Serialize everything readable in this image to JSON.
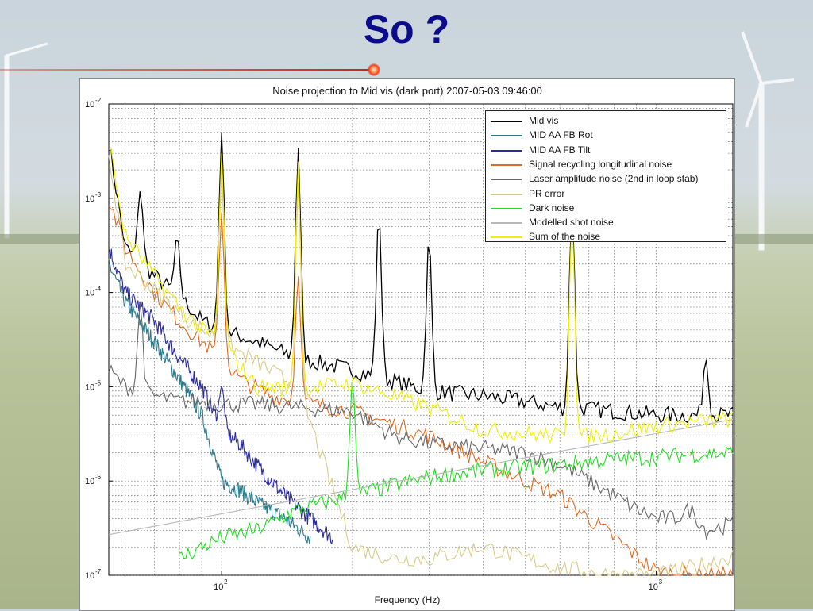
{
  "slide": {
    "title": "So ?"
  },
  "chart_data": {
    "type": "line",
    "title": "Noise projection to Mid vis (dark port) 2007-05-03 09:46:00",
    "xlabel": "Frequency (Hz)",
    "ylabel": "",
    "xscale": "log",
    "yscale": "log",
    "xlim": [
      55,
      1500
    ],
    "ylim": [
      1e-07,
      0.01
    ],
    "grid": true,
    "legend_position": "top-right",
    "x_ticks": [
      {
        "value": 100,
        "label": "10",
        "exp": "2"
      },
      {
        "value": 1000,
        "label": "10",
        "exp": "3"
      }
    ],
    "y_ticks": [
      {
        "value": 1e-07,
        "label": "10",
        "exp": "-7"
      },
      {
        "value": 1e-06,
        "label": "10",
        "exp": "-6"
      },
      {
        "value": 1e-05,
        "label": "10",
        "exp": "-5"
      },
      {
        "value": 0.0001,
        "label": "10",
        "exp": "-4"
      },
      {
        "value": 0.001,
        "label": "10",
        "exp": "-3"
      },
      {
        "value": 0.01,
        "label": "10",
        "exp": "-2"
      }
    ],
    "series": [
      {
        "name": "Mid vis",
        "color": "#000000",
        "x": [
          55,
          60,
          70,
          80,
          90,
          100,
          120,
          150,
          200,
          300,
          400,
          500,
          600,
          650,
          800,
          1000,
          1200,
          1500
        ],
        "y": [
          0.004,
          0.0003,
          0.00015,
          9e-05,
          5e-05,
          4e-05,
          3e-05,
          2e-05,
          1.5e-05,
          9e-06,
          8e-06,
          7e-06,
          6e-06,
          6e-06,
          5.5e-06,
          5e-06,
          5e-06,
          5e-06
        ],
        "peaks": [
          [
            65,
            0.0012
          ],
          [
            79,
            0.0004
          ],
          [
            100,
            0.005
          ],
          [
            150,
            0.0035
          ],
          [
            230,
            0.0007
          ],
          [
            300,
            0.0004
          ],
          [
            640,
            0.001
          ],
          [
            1300,
            2e-05
          ]
        ]
      },
      {
        "name": "MID AA FB Rot",
        "color": "#2a7a8c",
        "x": [
          55,
          60,
          70,
          80,
          90,
          100,
          110,
          120,
          140,
          160
        ],
        "y": [
          0.0002,
          8e-05,
          3e-05,
          1.2e-05,
          5e-06,
          1e-06,
          8e-07,
          6e-07,
          4e-07,
          2.5e-07
        ],
        "peaks": []
      },
      {
        "name": "MID AA FB Tilt",
        "color": "#2a2aa0",
        "x": [
          55,
          60,
          70,
          80,
          90,
          100,
          110,
          120,
          140,
          160,
          180
        ],
        "y": [
          0.0003,
          0.0001,
          5e-05,
          2e-05,
          1e-05,
          3.5e-06,
          2.5e-06,
          1.5e-06,
          7e-07,
          4e-07,
          2.5e-07
        ],
        "peaks": [
          [
            100,
            1e-05
          ]
        ]
      },
      {
        "name": "Signal recycling longitudinal noise",
        "color": "#e06820",
        "x": [
          55,
          60,
          70,
          80,
          90,
          100,
          110,
          130,
          150,
          200,
          300,
          400,
          500,
          600,
          700,
          800,
          900,
          1000,
          1200,
          1500
        ],
        "y": [
          0.001,
          0.0003,
          0.0001,
          5e-05,
          3e-05,
          2e-05,
          1.2e-05,
          8e-06,
          7e-06,
          5.5e-06,
          3e-06,
          1.6e-06,
          1e-06,
          7e-07,
          4e-07,
          2.5e-07,
          1.6e-07,
          1.1e-07,
          1e-07,
          1e-07
        ],
        "peaks": [
          [
            100,
            0.0007
          ],
          [
            150,
            0.00015
          ]
        ]
      },
      {
        "name": "Laser amplitude noise (2nd in loop stab)",
        "color": "#666666",
        "x": [
          55,
          60,
          70,
          80,
          90,
          100,
          120,
          150,
          200,
          250,
          300,
          400,
          500,
          600,
          700,
          800,
          900,
          1000,
          1100,
          1200,
          1300,
          1500
        ],
        "y": [
          1.5e-05,
          1e-05,
          8e-06,
          7e-06,
          7e-06,
          6.5e-06,
          6.5e-06,
          6e-06,
          5.5e-06,
          3e-06,
          2.5e-06,
          2.2e-06,
          2e-06,
          1.5e-06,
          1e-06,
          7e-07,
          5e-07,
          4e-07,
          4e-07,
          5e-07,
          3e-07,
          3.5e-07
        ],
        "peaks": [
          [
            65,
            8e-05
          ]
        ]
      },
      {
        "name": "PR error",
        "color": "#d8cc88",
        "x": [
          55,
          60,
          80,
          100,
          150,
          200,
          250,
          300,
          400,
          500,
          600,
          800,
          1000,
          1200,
          1500
        ],
        "y": [
          0.003,
          0.0002,
          6e-05,
          3e-05,
          1e-05,
          2e-07,
          1.5e-07,
          1.5e-07,
          2e-07,
          1.5e-07,
          1.2e-07,
          1e-07,
          1e-07,
          1.2e-07,
          1.6e-07
        ],
        "peaks": [
          [
            100,
            0.002
          ],
          [
            150,
            0.0015
          ]
        ]
      },
      {
        "name": "Dark noise",
        "color": "#22dd22",
        "x": [
          80,
          90,
          100,
          120,
          150,
          200,
          250,
          300,
          400,
          500,
          600,
          700,
          800,
          1000,
          1200,
          1500
        ],
        "y": [
          1.5e-07,
          2e-07,
          2.5e-07,
          3e-07,
          5e-07,
          7e-07,
          9e-07,
          1.1e-06,
          1.3e-06,
          1.4e-06,
          1.5e-06,
          1.6e-06,
          1.7e-06,
          1.8e-06,
          1.9e-06,
          2e-06
        ],
        "peaks": [
          [
            200,
            1.2e-05
          ]
        ]
      },
      {
        "name": "Modelled shot noise",
        "color": "#b8b8b8",
        "x": [
          55,
          1500
        ],
        "y": [
          2.7e-07,
          4.5e-06
        ],
        "peaks": []
      },
      {
        "name": "Sum of the noise",
        "color": "#f0f000",
        "x": [
          55,
          60,
          70,
          80,
          90,
          100,
          120,
          150,
          200,
          300,
          400,
          500,
          600,
          700,
          800,
          1000,
          1200,
          1500
        ],
        "y": [
          0.004,
          0.0004,
          0.00015,
          7e-05,
          4e-05,
          3e-05,
          1e-05,
          9.5e-06,
          1.1e-05,
          6e-06,
          3.5e-06,
          3.2e-06,
          3e-06,
          3e-06,
          3.2e-06,
          3.8e-06,
          4.2e-06,
          4.5e-06
        ],
        "peaks": [
          [
            100,
            0.003
          ],
          [
            150,
            0.0025
          ],
          [
            640,
            0.0008
          ]
        ]
      }
    ]
  }
}
